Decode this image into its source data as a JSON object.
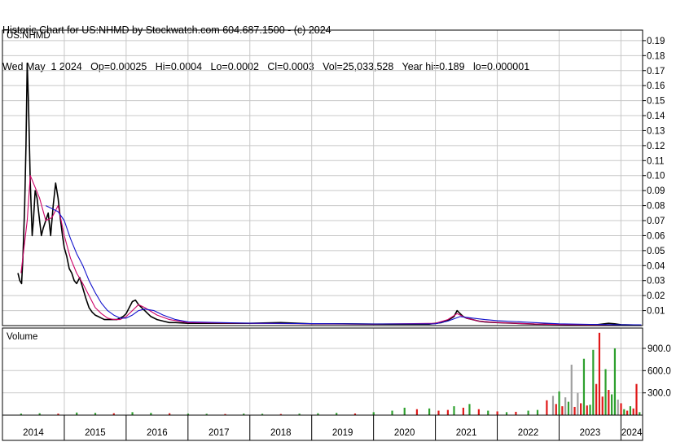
{
  "header": {
    "line1": "Historic Chart for US:NHMD by Stockwatch.com 604.687.1500 - (c) 2024",
    "line2": "Wed May  1 2024   Op=0.00025   Hi=0.0004   Lo=0.0002   Cl=0.0003   Vol=25,033,528   Year hi=0.189   lo=0.000001"
  },
  "colors": {
    "price": "#000000",
    "ma_short": "#cc0066",
    "ma_long": "#1010cc",
    "volume_up": "#2ea02e",
    "volume_down": "#e01818",
    "volume_flat": "#a0a0a0",
    "grid": "#c8c8c8"
  },
  "chart_data": [
    {
      "type": "line",
      "label": "US:NHMD",
      "ylim": [
        0,
        0.197
      ],
      "y_ticks": [
        "0.01",
        "0.02",
        "0.03",
        "0.04",
        "0.05",
        "0.06",
        "0.07",
        "0.08",
        "0.09",
        "0.10",
        "0.11",
        "0.12",
        "0.13",
        "0.14",
        "0.15",
        "0.16",
        "0.17",
        "0.18",
        "0.19"
      ],
      "x_ticks": [
        "2014",
        "2015",
        "2016",
        "2017",
        "2018",
        "2019",
        "2020",
        "2021",
        "2022",
        "2023",
        "2024"
      ],
      "xlim": [
        2014.0,
        2024.35
      ],
      "series": [
        {
          "role": "price",
          "x": [
            2014.25,
            2014.28,
            2014.31,
            2014.33,
            2014.36,
            2014.38,
            2014.4,
            2014.42,
            2014.45,
            2014.48,
            2014.5,
            2014.53,
            2014.56,
            2014.6,
            2014.63,
            2014.66,
            2014.7,
            2014.74,
            2014.78,
            2014.82,
            2014.86,
            2014.9,
            2014.94,
            2014.97,
            2015.0,
            2015.04,
            2015.08,
            2015.12,
            2015.16,
            2015.2,
            2015.25,
            2015.3,
            2015.35,
            2015.4,
            2015.45,
            2015.5,
            2015.55,
            2015.6,
            2015.65,
            2015.7,
            2015.75,
            2015.8,
            2015.85,
            2015.9,
            2015.95,
            2016.0,
            2016.05,
            2016.1,
            2016.15,
            2016.2,
            2016.25,
            2016.3,
            2016.35,
            2016.4,
            2016.5,
            2016.6,
            2016.7,
            2016.8,
            2017.0,
            2017.3,
            2017.6,
            2018.0,
            2018.5,
            2019.0,
            2019.5,
            2020.0,
            2020.5,
            2020.9,
            2021.0,
            2021.1,
            2021.2,
            2021.3,
            2021.35,
            2021.4,
            2021.45,
            2021.5,
            2021.6,
            2021.7,
            2021.8,
            2022.0,
            2022.3,
            2022.6,
            2023.0,
            2023.3,
            2023.6,
            2023.8,
            2023.9,
            2024.0,
            2024.2,
            2024.33
          ],
          "values": [
            0.035,
            0.03,
            0.028,
            0.045,
            0.08,
            0.12,
            0.175,
            0.15,
            0.095,
            0.06,
            0.07,
            0.09,
            0.085,
            0.07,
            0.06,
            0.065,
            0.07,
            0.075,
            0.06,
            0.08,
            0.095,
            0.085,
            0.07,
            0.06,
            0.052,
            0.046,
            0.038,
            0.035,
            0.03,
            0.028,
            0.032,
            0.025,
            0.018,
            0.012,
            0.009,
            0.007,
            0.006,
            0.005,
            0.004,
            0.004,
            0.004,
            0.004,
            0.004,
            0.005,
            0.006,
            0.008,
            0.012,
            0.016,
            0.017,
            0.014,
            0.012,
            0.01,
            0.008,
            0.006,
            0.004,
            0.003,
            0.002,
            0.002,
            0.0015,
            0.0015,
            0.0015,
            0.0015,
            0.002,
            0.0012,
            0.0012,
            0.001,
            0.001,
            0.001,
            0.0015,
            0.002,
            0.0035,
            0.006,
            0.01,
            0.008,
            0.006,
            0.005,
            0.004,
            0.003,
            0.0025,
            0.002,
            0.0015,
            0.001,
            0.0008,
            0.0006,
            0.0005,
            0.0015,
            0.0012,
            0.0006,
            0.0004,
            0.0003
          ]
        },
        {
          "role": "moving-average-short",
          "x": [
            2014.3,
            2014.4,
            2014.45,
            2014.5,
            2014.6,
            2014.7,
            2014.8,
            2014.9,
            2015.0,
            2015.1,
            2015.2,
            2015.3,
            2015.4,
            2015.5,
            2015.6,
            2015.7,
            2015.8,
            2015.9,
            2016.0,
            2016.1,
            2016.2,
            2016.3,
            2016.5,
            2016.7,
            2017.0,
            2018.0,
            2019.0,
            2020.0,
            2021.0,
            2021.2,
            2021.35,
            2021.5,
            2021.7,
            2022.0,
            2022.5,
            2023.0,
            2023.5,
            2024.0,
            2024.33
          ],
          "values": [
            0.035,
            0.07,
            0.1,
            0.095,
            0.085,
            0.07,
            0.072,
            0.08,
            0.06,
            0.045,
            0.035,
            0.028,
            0.02,
            0.012,
            0.008,
            0.005,
            0.004,
            0.004,
            0.006,
            0.01,
            0.014,
            0.012,
            0.007,
            0.004,
            0.002,
            0.0015,
            0.0012,
            0.001,
            0.0015,
            0.004,
            0.008,
            0.005,
            0.003,
            0.002,
            0.0012,
            0.0007,
            0.0006,
            0.0005,
            0.0004
          ]
        },
        {
          "role": "moving-average-long",
          "x": [
            2014.7,
            2014.9,
            2015.0,
            2015.1,
            2015.2,
            2015.3,
            2015.4,
            2015.5,
            2015.6,
            2015.7,
            2015.8,
            2015.9,
            2016.0,
            2016.1,
            2016.2,
            2016.3,
            2016.45,
            2016.6,
            2016.8,
            2017.0,
            2018.0,
            2019.0,
            2020.0,
            2021.0,
            2021.2,
            2021.4,
            2021.6,
            2021.8,
            2022.0,
            2022.5,
            2023.0,
            2023.5,
            2024.0,
            2024.33
          ],
          "values": [
            0.08,
            0.076,
            0.07,
            0.058,
            0.048,
            0.04,
            0.03,
            0.022,
            0.015,
            0.01,
            0.007,
            0.005,
            0.005,
            0.007,
            0.01,
            0.011,
            0.01,
            0.007,
            0.004,
            0.0025,
            0.0016,
            0.0013,
            0.0011,
            0.0012,
            0.003,
            0.006,
            0.005,
            0.004,
            0.0033,
            0.0022,
            0.0012,
            0.0008,
            0.0006,
            0.0005
          ]
        }
      ]
    },
    {
      "type": "bar",
      "label": "Volume",
      "ylim": [
        0,
        1130
      ],
      "y_ticks": [
        "300.0",
        "600.0",
        "900.0"
      ],
      "x": [
        2014.3,
        2014.6,
        2014.9,
        2015.2,
        2015.5,
        2015.8,
        2016.1,
        2016.4,
        2016.7,
        2017.0,
        2017.3,
        2017.6,
        2017.9,
        2018.2,
        2018.5,
        2018.8,
        2019.1,
        2019.4,
        2019.7,
        2020.0,
        2020.3,
        2020.5,
        2020.7,
        2020.9,
        2021.05,
        2021.2,
        2021.3,
        2021.45,
        2021.55,
        2021.7,
        2021.85,
        2022.0,
        2022.15,
        2022.3,
        2022.5,
        2022.65,
        2022.8,
        2022.9,
        2022.95,
        2023.0,
        2023.05,
        2023.1,
        2023.15,
        2023.2,
        2023.25,
        2023.3,
        2023.35,
        2023.4,
        2023.45,
        2023.5,
        2023.55,
        2023.6,
        2023.65,
        2023.7,
        2023.75,
        2023.8,
        2023.85,
        2023.9,
        2023.95,
        2024.0,
        2024.05,
        2024.1,
        2024.15,
        2024.2,
        2024.25,
        2024.3
      ],
      "values": [
        20,
        25,
        20,
        35,
        30,
        25,
        40,
        30,
        25,
        20,
        18,
        15,
        20,
        18,
        15,
        20,
        25,
        30,
        22,
        40,
        60,
        100,
        80,
        90,
        60,
        70,
        120,
        100,
        150,
        80,
        60,
        50,
        40,
        45,
        60,
        70,
        200,
        260,
        150,
        320,
        120,
        240,
        180,
        680,
        110,
        300,
        160,
        760,
        130,
        140,
        880,
        420,
        1110,
        250,
        620,
        340,
        280,
        900,
        210,
        160,
        80,
        60,
        120,
        90,
        420,
        40
      ],
      "colors": [
        "up",
        "up",
        "down",
        "up",
        "up",
        "down",
        "up",
        "up",
        "down",
        "up",
        "up",
        "down",
        "up",
        "up",
        "down",
        "up",
        "up",
        "up",
        "down",
        "up",
        "up",
        "up",
        "down",
        "up",
        "down",
        "down",
        "up",
        "down",
        "up",
        "down",
        "up",
        "down",
        "up",
        "down",
        "up",
        "up",
        "down",
        "flat",
        "down",
        "up",
        "down",
        "flat",
        "up",
        "flat",
        "down",
        "flat",
        "down",
        "up",
        "down",
        "up",
        "up",
        "down",
        "down",
        "down",
        "up",
        "down",
        "up",
        "up",
        "flat",
        "down",
        "up",
        "down",
        "up",
        "down",
        "down",
        "up"
      ]
    }
  ]
}
